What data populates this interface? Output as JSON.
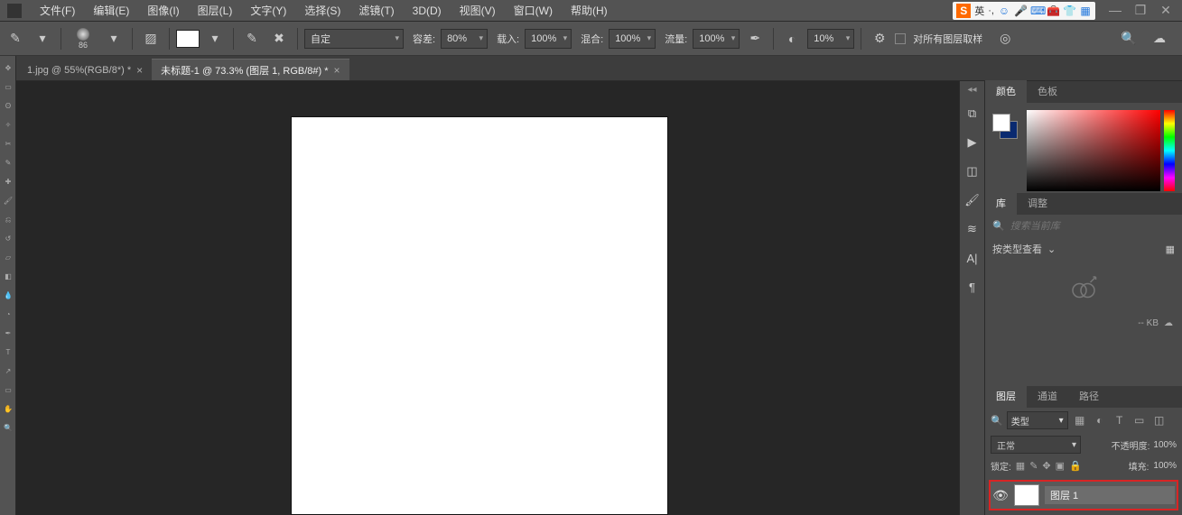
{
  "menu": {
    "file": "文件(F)",
    "edit": "编辑(E)",
    "image": "图像(I)",
    "layer": "图层(L)",
    "text": "文字(Y)",
    "select": "选择(S)",
    "filter": "滤镜(T)",
    "threeD": "3D(D)",
    "view": "视图(V)",
    "window": "窗口(W)",
    "help": "帮助(H)"
  },
  "ime": {
    "logo": "S",
    "lang": "英",
    "dot": "·,"
  },
  "options": {
    "brush_size": "86",
    "mode_label": "自定",
    "tol_label": "容差:",
    "tol_value": "80%",
    "load_label": "载入:",
    "load_value": "100%",
    "blend_label": "混合:",
    "blend_value": "100%",
    "flow_label": "流量:",
    "flow_value": "100%",
    "wet_value": "10%",
    "sample_all": "对所有图层取样"
  },
  "tabs": {
    "tab1": "1.jpg @ 55%(RGB/8*) *",
    "tab2": "未标题-1 @ 73.3% (图层 1, RGB/8#) *"
  },
  "panels": {
    "color": "颜色",
    "swatches": "色板",
    "lib": "库",
    "adjust": "调整",
    "layers": "图层",
    "channels": "通道",
    "paths": "路径",
    "search_placeholder": "搜索当前库",
    "view_by": "按类型查看",
    "kb": "-- KB",
    "filter_kind": "类型",
    "blend_mode": "正常",
    "opacity_lbl": "不透明度:",
    "opacity_val": "100%",
    "lock_lbl": "锁定:",
    "fill_lbl": "填充:",
    "fill_val": "100%",
    "layer1_name": "图层 1"
  }
}
